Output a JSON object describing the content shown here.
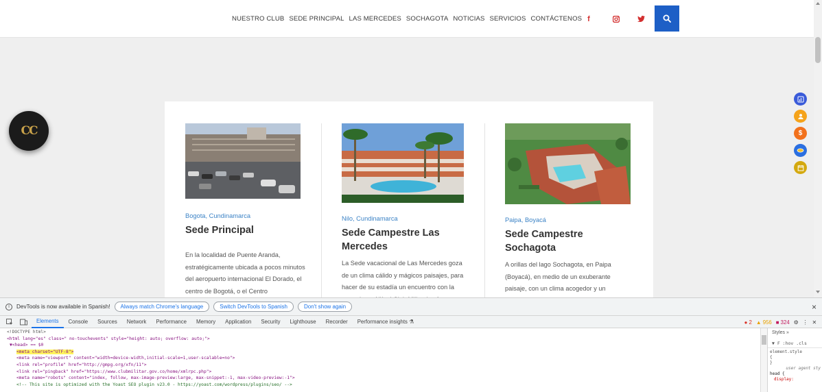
{
  "nav": {
    "items": [
      "NUESTRO CLUB",
      "SEDE PRINCIPAL",
      "LAS MERCEDES",
      "SOCHAGOTA",
      "NOTICIAS",
      "SERVICIOS",
      "CONTÁCTENOS"
    ],
    "social": {
      "facebook": "f",
      "instagram": "instagram-icon",
      "twitter": "twitter-icon"
    },
    "search_icon": "search-icon"
  },
  "logo": {
    "text": "CC"
  },
  "floating_icons": [
    "chart-icon",
    "user-icon",
    "dollar-icon",
    "link-icon",
    "calendar-icon"
  ],
  "sedes": [
    {
      "location": "Bogota, Cundinamarca",
      "title": "Sede Principal",
      "description": "En la localidad de Puente Aranda, estratégicamente ubicada a pocos minutos del aeropuerto internacional El Dorado, el centro de Bogotá, o el Centro"
    },
    {
      "location": "Nilo, Cundinamarca",
      "title": "Sede Campestre Las Mercedes",
      "description": "La Sede vacacional de Las Mercedes goza de un clima cálido y mágicos paisajes, para hacer de su estadía un encuentro con la naturaleza. Allí, el Club Militar le ofrece cinco"
    },
    {
      "location": "Paipa, Boyacá",
      "title": "Sede Campestre Sochagota",
      "description": "A orillas del lago Sochagota, en Paipa (Boyacá), en medio de un exuberante paisaje, con un clima acogedor y un ambiente propicio para el descanso y la relajación, el Club Militar ofrece a sus socios unas instalaciones que no"
    }
  ],
  "devtools": {
    "infobar": {
      "message": "DevTools is now available in Spanish!",
      "btn_match": "Always match Chrome's language",
      "btn_switch": "Switch DevTools to Spanish",
      "btn_dont": "Don't show again",
      "close": "×"
    },
    "tabs": [
      "Elements",
      "Console",
      "Sources",
      "Network",
      "Performance",
      "Memory",
      "Application",
      "Security",
      "Lighthouse",
      "Recorder",
      "Performance insights ⚗"
    ],
    "active_tab": "Elements",
    "counts": {
      "errors": "2",
      "warnings": "956",
      "issues": "324"
    },
    "dom_lines": [
      "<!DOCTYPE html>",
      "<html lang=\"es\" class=\" no-touchevents\" style=\"height: auto; overflow: auto;\">",
      "▼<head> == $0",
      "<meta charset=\"UTF-8\">",
      "<meta name=\"viewport\" content=\"width=device-width,initial-scale=1,user-scalable=no\">",
      "<link rel=\"profile\" href=\"http://gmpg.org/xfn/11\">",
      "<link rel=\"pingback\" href=\"https://www.clubmilitar.gov.co/home/xmlrpc.php\">",
      "<meta name=\"robots\" content=\"index, follow, max-image-preview:large, max-snippet:-1, max-video-preview:-1\">",
      "<!-- This site is optimized with the Yoast SEO plugin v23.0 - https://yoast.com/wordpress/plugins/seo/ -->"
    ],
    "styles": {
      "tabs": "Styles  »",
      "filter": "▼ F :hov .cls",
      "element_style": "element.style",
      "open_brace": "{",
      "close_brace": "}",
      "ua_label": "user agent sty",
      "ua_selector": "head {",
      "ua_prop": "display:"
    }
  },
  "colors": {
    "nav_blue": "#1d5fc6",
    "social_red": "#d32f2f",
    "location_blue": "#3c83c6",
    "devtools_blue": "#1a73e8",
    "highlight": "#fff35c"
  }
}
